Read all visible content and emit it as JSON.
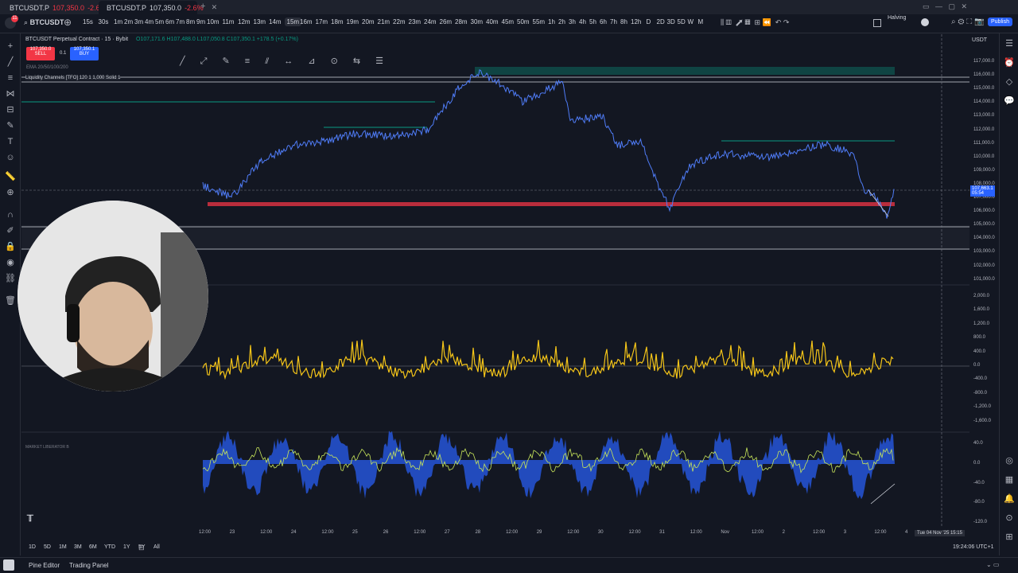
{
  "browser_tabs": [
    {
      "title": "BTCUSDT.P",
      "price": "107,350.0",
      "change": "-2.6%"
    },
    {
      "title": "BTCUSDT.P",
      "price": "107,350.0",
      "change": "-2.6%"
    }
  ],
  "toolbar": {
    "symbol": "BTCUSDT",
    "timeframes": [
      "15s",
      "30s",
      "1m",
      "2m",
      "3m",
      "4m",
      "5m",
      "6m",
      "7m",
      "8m",
      "9m",
      "10m",
      "11m",
      "12m",
      "13m",
      "14m",
      "15m",
      "16m",
      "17m",
      "18m",
      "19m",
      "20m",
      "21m",
      "22m",
      "23m",
      "24m",
      "26m",
      "28m",
      "30m",
      "40m",
      "45m",
      "50m",
      "55m",
      "1h",
      "2h",
      "3h",
      "4h",
      "5h",
      "6h",
      "7h",
      "8h",
      "12h",
      "D",
      "2D",
      "3D",
      "5D",
      "W",
      "M"
    ],
    "active_timeframe": "15m",
    "halving_label": "Halving",
    "publish_label": "Publish",
    "currency": "USDT"
  },
  "legend": {
    "title": "BTCUSDT Perpetual Contract · 15 · Bybit",
    "ohlc": "O107,171.6 H107,488.0 L107,050.8 C107,350.1 +178.5 (+0.17%)",
    "sell_price": "107,350.0",
    "sell_label": "SELL",
    "spread": "0.1",
    "buy_price": "107,350.1",
    "buy_label": "BUY",
    "ema": "EMA 20/50/100/200",
    "liquidity": "Liquidity Channels [TFO] 120 1 1,000 Solid 1"
  },
  "price_axis": [
    "117,000.0",
    "116,000.0",
    "115,000.0",
    "114,000.0",
    "113,000.0",
    "112,000.0",
    "111,000.0",
    "110,000.0",
    "109,000.0",
    "108,000.0",
    "107,000.0",
    "106,000.0",
    "105,000.0",
    "104,000.0",
    "103,000.0",
    "102,000.0",
    "101,000.0"
  ],
  "current_price": "107,663.1",
  "countdown": "05:54",
  "osc_axis": [
    "2,000.0",
    "1,600.0",
    "1,200.0",
    "800.0",
    "400.0",
    "0.0",
    "-400.0",
    "-800.0",
    "-1,200.0",
    "-1,600.0"
  ],
  "ml_axis": [
    "40.0",
    "0.0",
    "-40.0",
    "-80.0",
    "-120.0"
  ],
  "indicator_name": "MARKET LIBERATOR B",
  "time_axis": [
    "12:00",
    "23",
    "12:00",
    "24",
    "12:00",
    "25",
    "26",
    "12:00",
    "27",
    "28",
    "12:00",
    "29",
    "12:00",
    "30",
    "12:00",
    "31",
    "12:00",
    "Nov",
    "12:00",
    "2",
    "12:00",
    "3",
    "12:00",
    "4"
  ],
  "crosshair_time": "Tue 04 Nov '25  15:15",
  "ranges": [
    "1D",
    "5D",
    "1M",
    "3M",
    "6M",
    "YTD",
    "1Y",
    "5Y",
    "All"
  ],
  "clock": "19:24:06 UTC+1",
  "footer_tabs": [
    "Pine Editor",
    "Trading Panel"
  ],
  "colors": {
    "bg": "#131722",
    "price_line": "#4f7cf7",
    "accent": "#2962ff",
    "red": "#f23645",
    "green": "#089981",
    "yellow": "#f5c518"
  },
  "icons": [
    "crosshair-icon",
    "trend-line-icon",
    "fib-icon",
    "brush-icon",
    "text-icon",
    "emoji-icon",
    "ruler-icon",
    "zoom-icon",
    "magnet-icon",
    "lock-icon",
    "trash-icon"
  ]
}
